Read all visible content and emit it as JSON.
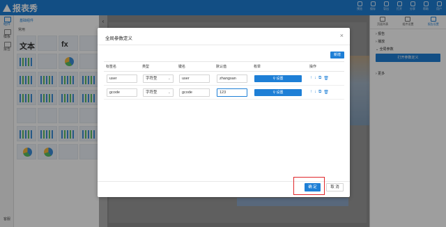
{
  "app": {
    "title": "报表秀"
  },
  "toolbar": {
    "items": [
      {
        "icon": "preview-icon",
        "label": "预览"
      },
      {
        "icon": "save-icon",
        "label": "保存"
      },
      {
        "icon": "export-icon",
        "label": "导出"
      },
      {
        "icon": "print-icon",
        "label": "打开"
      },
      {
        "icon": "share-icon",
        "label": "分享"
      },
      {
        "icon": "help-icon",
        "label": "帮助"
      },
      {
        "icon": "user-icon",
        "label": "用户"
      }
    ]
  },
  "leftnav": {
    "items": [
      {
        "label": "组件",
        "active": true
      },
      {
        "label": "模板",
        "active": false
      },
      {
        "label": "报告",
        "active": false
      }
    ],
    "help": "客服"
  },
  "palette": {
    "tab": "基础组件",
    "section": "常用",
    "text_thumb": "文本",
    "fx_thumb": "fx"
  },
  "right_panel": {
    "tabs": [
      "页面列表",
      "组件设置",
      "报告设置"
    ],
    "items": [
      "报告",
      "播放",
      "全局参数"
    ],
    "open_button": "打开参数定义",
    "more": "更多"
  },
  "modal": {
    "title": "全局参数定义",
    "add_button": "新增",
    "columns": [
      "标签名",
      "类型",
      "键名",
      "默认值",
      "枚举",
      "操作"
    ],
    "rows": [
      {
        "label": "user",
        "type": "字符型",
        "key": "user",
        "default": "zhangsan",
        "enum_button": "设置"
      },
      {
        "label": "gcode",
        "type": "字符型",
        "key": "gcode",
        "default": "123",
        "enum_button": "设置"
      }
    ],
    "ok_button": "确 定",
    "cancel_button": "取 消"
  }
}
